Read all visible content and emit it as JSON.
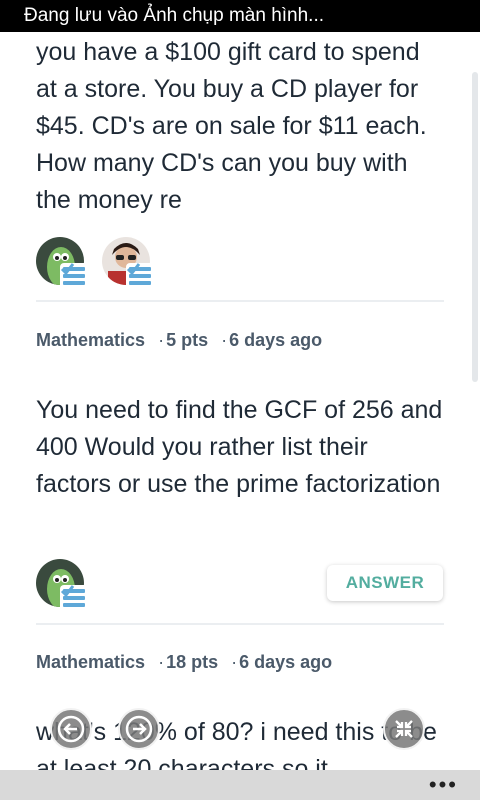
{
  "status_bar": {
    "text": "Đang lưu vào Ảnh chụp màn hình..."
  },
  "questions": [
    {
      "text": "you have a $100 gift card to spend at a store. You buy a CD player for $45. CD's are on sale for $11 each. How many CD's can you buy with the money re",
      "subject": "Mathematics",
      "points": "5 pts",
      "time": "6 days ago"
    },
    {
      "text": "You need to find the GCF of 256 and 400 Would you rather list their factors or use the prime factorization",
      "subject": "Mathematics",
      "points": "18 pts",
      "time": "6 days ago",
      "answer_label": "ANSWER"
    },
    {
      "text": "what's 120% of 80? i need this to be at least 20 characters so it"
    }
  ],
  "app_bar": {
    "more": "•••"
  },
  "colors": {
    "accent": "#53ad9f",
    "text": "#1f2a36",
    "meta": "#4b5a6a"
  }
}
